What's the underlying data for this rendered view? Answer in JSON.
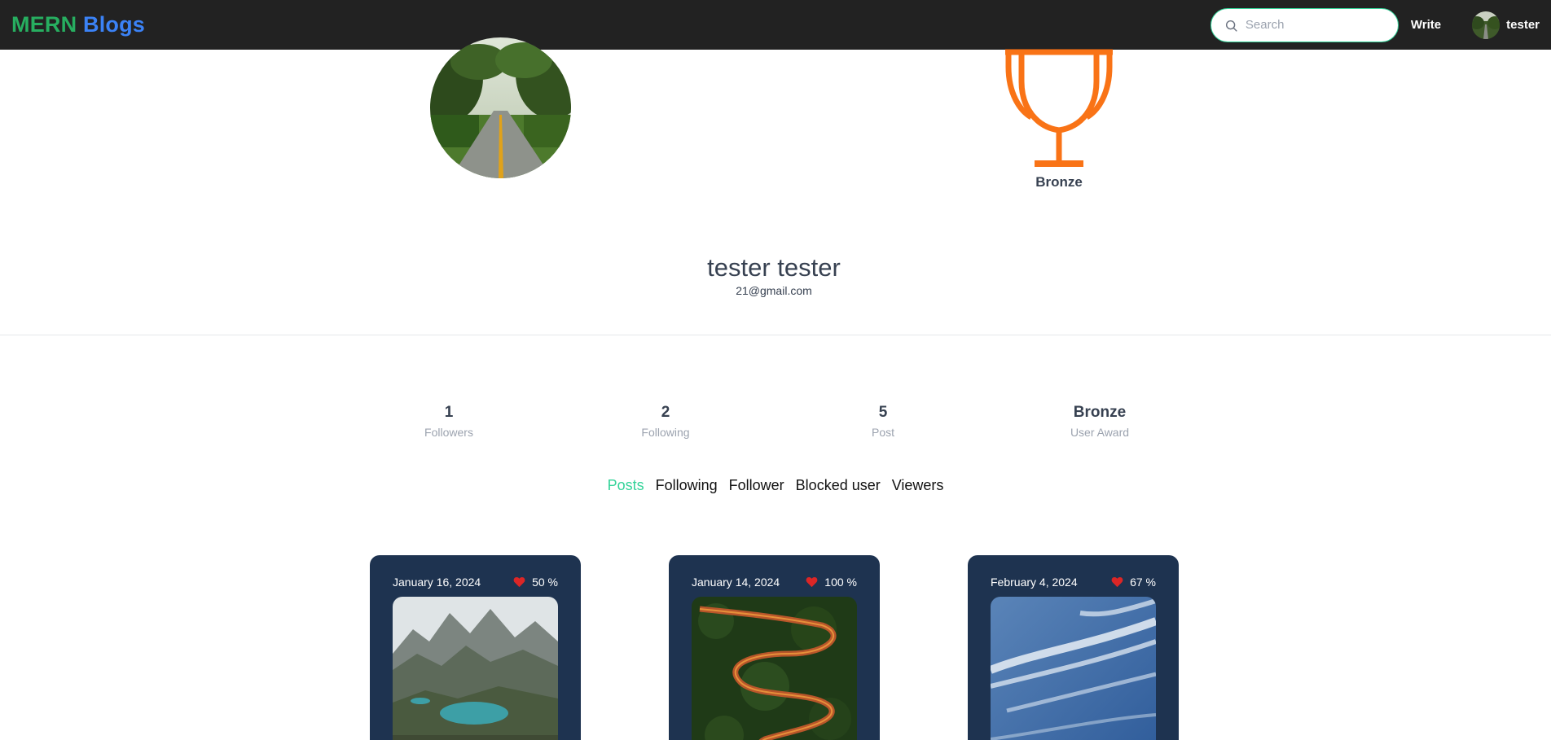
{
  "navbar": {
    "brand_part1": "MERN",
    "brand_part2": "Blogs",
    "search_placeholder": "Search",
    "write_label": "Write",
    "user_name": "tester"
  },
  "profile": {
    "award_label": "Bronze",
    "full_name": "tester tester",
    "email": "21@gmail.com"
  },
  "stats": [
    {
      "value": "1",
      "label": "Followers"
    },
    {
      "value": "2",
      "label": "Following"
    },
    {
      "value": "5",
      "label": "Post"
    },
    {
      "value": "Bronze",
      "label": "User Award"
    }
  ],
  "tabs": [
    {
      "label": "Posts",
      "active": true
    },
    {
      "label": "Following",
      "active": false
    },
    {
      "label": "Follower",
      "active": false
    },
    {
      "label": "Blocked user",
      "active": false
    },
    {
      "label": "Viewers",
      "active": false
    }
  ],
  "posts": [
    {
      "date": "January 16, 2024",
      "likes": "50 %",
      "image": "mountain-lake"
    },
    {
      "date": "January 14, 2024",
      "likes": "100 %",
      "image": "winding-road-forest"
    },
    {
      "date": "February 4, 2024",
      "likes": "67 %",
      "image": "blue-sky-clouds"
    }
  ],
  "colors": {
    "navbar_bg": "#222222",
    "brand_green": "#27ae60",
    "brand_blue": "#3b82f6",
    "accent_green": "#34d399",
    "trophy_orange": "#f97316",
    "card_bg": "#1e3350",
    "heart_red": "#dc2626"
  }
}
